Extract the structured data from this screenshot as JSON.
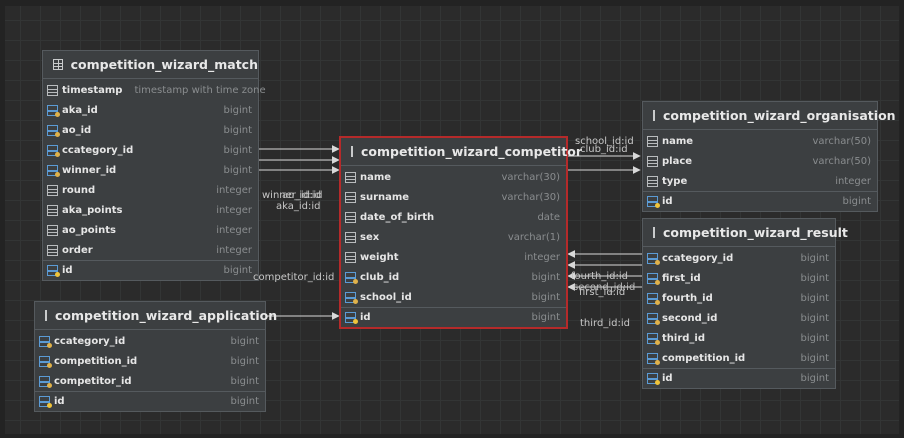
{
  "colors": {
    "background": "#2b2b2b",
    "table_bg": "#3c3f41",
    "selected_border": "#b52a2a",
    "line": "#d8d8d8"
  },
  "tables": {
    "match": {
      "name": "competition_wizard_match",
      "columns": [
        {
          "name": "timestamp",
          "type": "timestamp with time zone",
          "icon": "column-icon"
        },
        {
          "name": "aka_id",
          "type": "bigint",
          "icon": "foreign-key-icon"
        },
        {
          "name": "ao_id",
          "type": "bigint",
          "icon": "foreign-key-icon"
        },
        {
          "name": "ccategory_id",
          "type": "bigint",
          "icon": "foreign-key-icon"
        },
        {
          "name": "winner_id",
          "type": "bigint",
          "icon": "foreign-key-icon"
        },
        {
          "name": "round",
          "type": "integer",
          "icon": "column-icon"
        },
        {
          "name": "aka_points",
          "type": "integer",
          "icon": "column-icon"
        },
        {
          "name": "ao_points",
          "type": "integer",
          "icon": "column-icon"
        },
        {
          "name": "order",
          "type": "integer",
          "icon": "column-icon"
        }
      ],
      "pk": {
        "name": "id",
        "type": "bigint"
      }
    },
    "application": {
      "name": "competition_wizard_application",
      "columns": [
        {
          "name": "ccategory_id",
          "type": "bigint",
          "icon": "foreign-key-icon"
        },
        {
          "name": "competition_id",
          "type": "bigint",
          "icon": "foreign-key-icon"
        },
        {
          "name": "competitor_id",
          "type": "bigint",
          "icon": "foreign-key-icon"
        }
      ],
      "pk": {
        "name": "id",
        "type": "bigint"
      }
    },
    "competitor": {
      "name": "competition_wizard_competitor",
      "columns": [
        {
          "name": "name",
          "type": "varchar(30)",
          "icon": "column-icon"
        },
        {
          "name": "surname",
          "type": "varchar(30)",
          "icon": "column-icon"
        },
        {
          "name": "date_of_birth",
          "type": "date",
          "icon": "column-icon"
        },
        {
          "name": "sex",
          "type": "varchar(1)",
          "icon": "column-icon"
        },
        {
          "name": "weight",
          "type": "integer",
          "icon": "column-icon"
        },
        {
          "name": "club_id",
          "type": "bigint",
          "icon": "foreign-key-icon"
        },
        {
          "name": "school_id",
          "type": "bigint",
          "icon": "foreign-key-icon"
        }
      ],
      "pk": {
        "name": "id",
        "type": "bigint"
      }
    },
    "organisation": {
      "name": "competition_wizard_organisation",
      "columns": [
        {
          "name": "name",
          "type": "varchar(50)",
          "icon": "column-icon"
        },
        {
          "name": "place",
          "type": "varchar(50)",
          "icon": "column-icon"
        },
        {
          "name": "type",
          "type": "integer",
          "icon": "column-icon"
        }
      ],
      "pk": {
        "name": "id",
        "type": "bigint"
      }
    },
    "result": {
      "name": "competition_wizard_result",
      "columns": [
        {
          "name": "ccategory_id",
          "type": "bigint",
          "icon": "foreign-key-icon"
        },
        {
          "name": "first_id",
          "type": "bigint",
          "icon": "foreign-key-icon"
        },
        {
          "name": "fourth_id",
          "type": "bigint",
          "icon": "foreign-key-icon"
        },
        {
          "name": "second_id",
          "type": "bigint",
          "icon": "foreign-key-icon"
        },
        {
          "name": "third_id",
          "type": "bigint",
          "icon": "foreign-key-icon"
        },
        {
          "name": "competition_id",
          "type": "bigint",
          "icon": "foreign-key-icon"
        }
      ],
      "pk": {
        "name": "id",
        "type": "bigint"
      }
    }
  },
  "labels": {
    "winner_id": "winner_id:id",
    "aka_id": "aka_id:id",
    "ao_id": "ao_id:id",
    "competitor_id": "competitor_id:id",
    "school_id": "school_id:id",
    "club_id": "club_id:id",
    "fourth_id": "fourth_id:id",
    "first_id": "first_id:id",
    "second_id": "second_id:id",
    "third_id": "third_id:id"
  }
}
